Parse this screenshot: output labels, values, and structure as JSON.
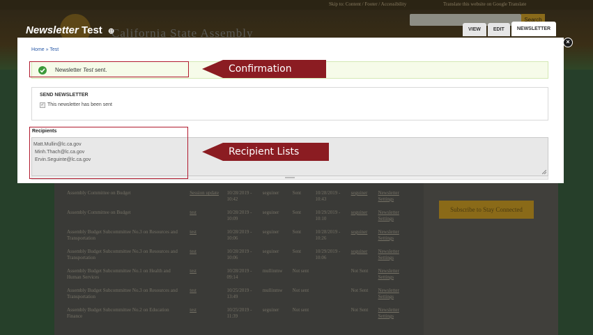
{
  "background": {
    "top_links": "Skip to: Content / Footer / Accessibility",
    "translate_link": "Translate this website on Google Translate",
    "search_button": "Search",
    "site_name": "California State Assembly",
    "subscribe_button": "Subscribe to Stay Connected",
    "table_rows": [
      {
        "name": "Assembly Committee on Budget",
        "subject": "Session update",
        "date": "10/28/2019 - 10:42",
        "user": "seguiner",
        "status": "Sent",
        "sent_date": "10/28/2019 - 10:43",
        "sent_by": "seguiner",
        "settings": "Newsletter Settings"
      },
      {
        "name": "Assembly Committee on Budget",
        "subject": "test",
        "date": "10/28/2019 - 10:09",
        "user": "seguiner",
        "status": "Sent",
        "sent_date": "10/29/2019 - 10:10",
        "sent_by": "seguiner",
        "settings": "Newsletter Settings"
      },
      {
        "name": "Assembly Budget Subcommittee No.3 on Resources and Transportation",
        "subject": "test",
        "date": "10/28/2019 - 10:06",
        "user": "seguiner",
        "status": "Sent",
        "sent_date": "10/28/2019 - 10:26",
        "sent_by": "seguiner",
        "settings": "Newsletter Settings"
      },
      {
        "name": "Assembly Budget Subcommittee No.3 on Resources and Transportation",
        "subject": "test",
        "date": "10/28/2019 - 10:06",
        "user": "seguiner",
        "status": "Sent",
        "sent_date": "10/29/2019 - 10:06",
        "sent_by": "seguiner",
        "settings": "Newsletter Settings"
      },
      {
        "name": "Assembly Budget Subcommittee No.1 on Health and Human Services",
        "subject": "test",
        "date": "10/28/2019 - 09:14",
        "user": "mullinmw",
        "status": "Not sent",
        "sent_date": "",
        "sent_by": "Not Sent",
        "settings": "Newsletter Settings"
      },
      {
        "name": "Assembly Budget Subcommittee No.3 on Resources and Transportation",
        "subject": "test",
        "date": "10/25/2019 - 13:49",
        "user": "mullinmw",
        "status": "Not sent",
        "sent_date": "",
        "sent_by": "Not Sent",
        "settings": "Newsletter Settings"
      },
      {
        "name": "Assembly Budget Subcommittee No.2 on Education Finance",
        "subject": "test",
        "date": "10/25/2019 - 11:39",
        "user": "seguiner",
        "status": "Not sent",
        "sent_date": "",
        "sent_by": "Not Sent",
        "settings": "Newsletter Settings"
      }
    ]
  },
  "modal": {
    "title_italic": "Newsletter",
    "title_plain": "Test",
    "collapse_glyph": "⊕",
    "tabs": [
      {
        "label": "VIEW",
        "active": false
      },
      {
        "label": "EDIT",
        "active": false
      },
      {
        "label": "NEWSLETTER",
        "active": true
      }
    ],
    "close_glyph": "×",
    "breadcrumb": "Home » Test",
    "message": {
      "prefix": "Newsletter",
      "name": "Test",
      "suffix": "sent."
    },
    "send_section": {
      "heading": "SEND NEWSLETTER",
      "checkmark": "✓",
      "status": "This newsletter has been sent"
    },
    "recipients": {
      "label": "Recipients",
      "emails": [
        "Matt.Mullin@lc.ca.gov",
        "Minh.Thach@lc.ca.gov",
        "Ervin.Seguinte@lc.ca.gov"
      ]
    }
  },
  "annotations": {
    "confirmation": "Confirmation",
    "recipient_lists": "Recipient Lists",
    "color": "#8b1c22"
  }
}
